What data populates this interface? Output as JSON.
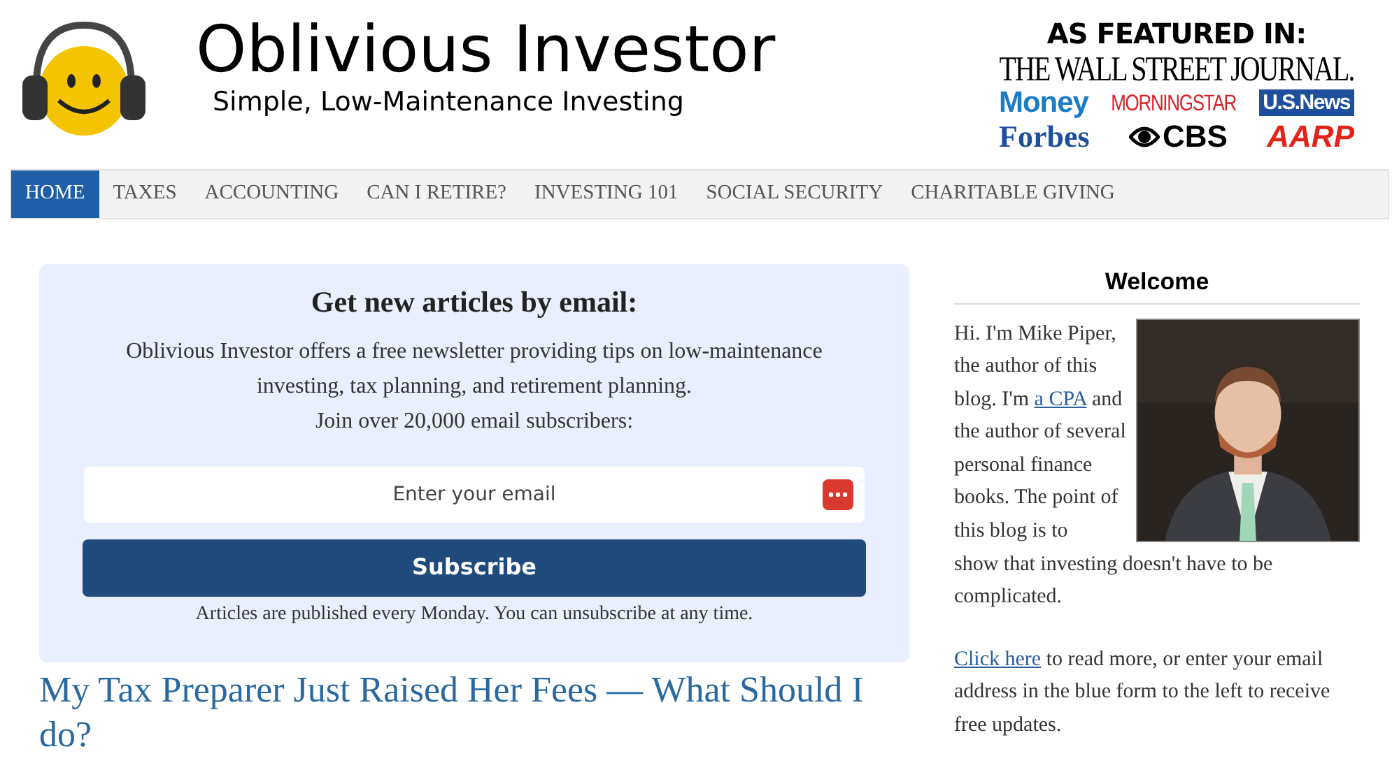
{
  "header": {
    "site_title": "Oblivious Investor",
    "tagline": "Simple, Low-Maintenance Investing",
    "featured_heading": "AS FEATURED IN:",
    "featured": [
      [
        {
          "kind": "wsj",
          "name": "THE WALL STREET JOURNAL."
        }
      ],
      [
        {
          "kind": "money",
          "name": "Money"
        },
        {
          "kind": "morningstar",
          "name": "MORNINGSTAR"
        },
        {
          "kind": "usnews",
          "name": "U.S.News"
        }
      ],
      [
        {
          "kind": "forbes",
          "name": "Forbes"
        },
        {
          "kind": "cbs",
          "name": "CBS"
        },
        {
          "kind": "aarp",
          "name": "AARP"
        }
      ]
    ]
  },
  "nav": [
    {
      "label": "HOME",
      "selected": true
    },
    {
      "label": "TAXES",
      "selected": false
    },
    {
      "label": "ACCOUNTING",
      "selected": false
    },
    {
      "label": "CAN I RETIRE?",
      "selected": false
    },
    {
      "label": "INVESTING 101",
      "selected": false
    },
    {
      "label": "SOCIAL SECURITY",
      "selected": false
    },
    {
      "label": "CHARITABLE GIVING",
      "selected": false
    }
  ],
  "signup": {
    "title": "Get new articles by email:",
    "description": "Oblivious Investor offers a free newsletter providing tips on low-maintenance investing, tax planning, and retirement planning.",
    "subscribers": "Join over 20,000 email subscribers:",
    "placeholder": "Enter your email",
    "button": "Subscribe",
    "note": "Articles are published every Monday. You can unsubscribe at any time."
  },
  "article": {
    "title": "My Tax Preparer Just Raised Her Fees — What Should I do?"
  },
  "sidebar": {
    "title": "Welcome",
    "photo": {
      "kind": "picture"
    },
    "intro_beside_photo": [
      {
        "kind": "text",
        "text": "Hi. I'm Mike Piper, the author of this blog. I'm "
      },
      {
        "kind": "link",
        "text": "a CPA"
      },
      {
        "kind": "text",
        "text": " and the author of several personal finance books. The point of this blog is to"
      }
    ],
    "paragraphs": [
      [
        {
          "kind": "text",
          "text": "show that investing doesn't have to be complicated."
        }
      ],
      [
        {
          "kind": "link",
          "text": "Click here"
        },
        {
          "kind": "text",
          "text": " to read more, or enter your email address in the blue form to the left to receive free updates."
        }
      ]
    ]
  }
}
